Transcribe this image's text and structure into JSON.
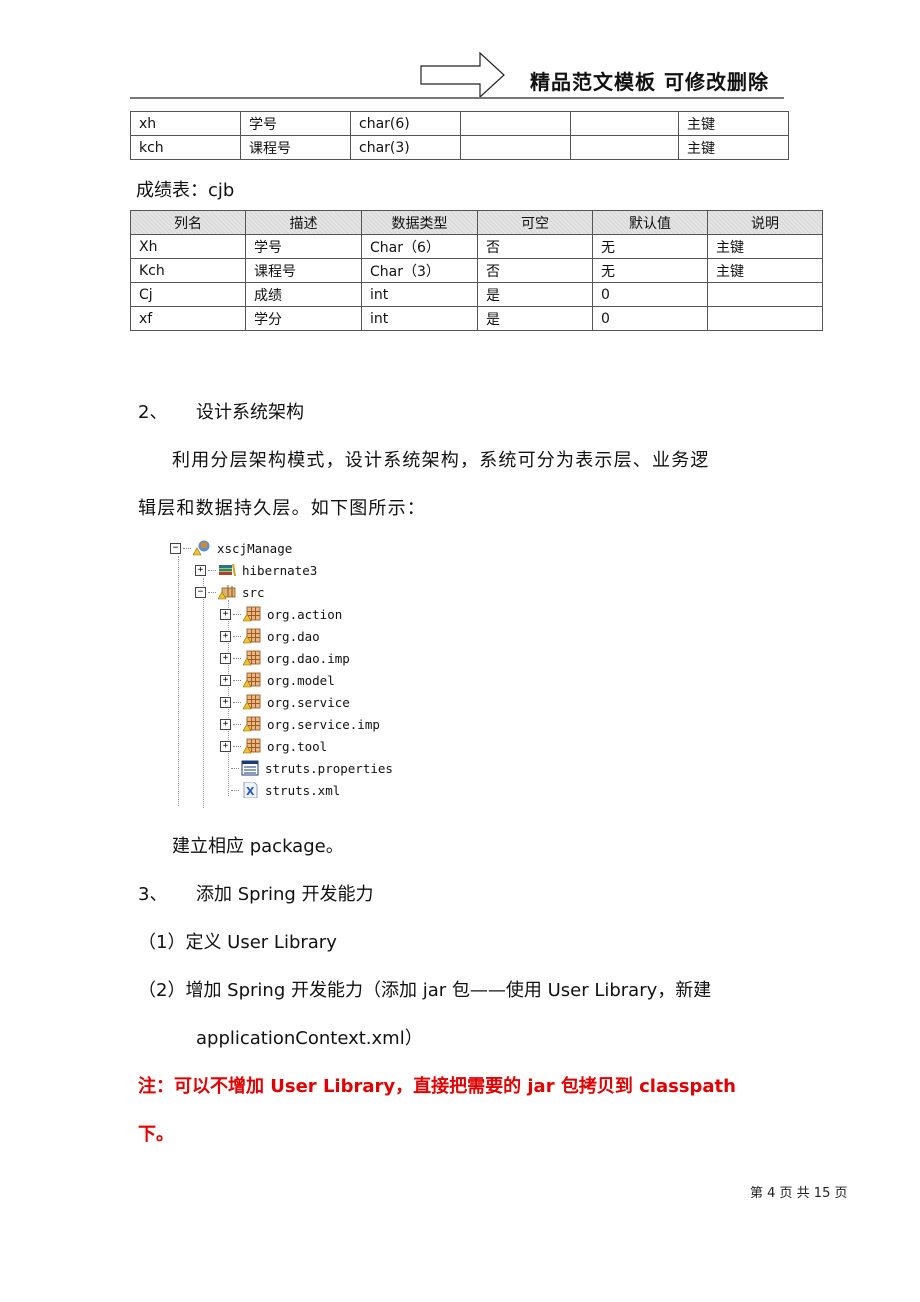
{
  "header": {
    "title": "精品范文模板 可修改删除",
    "arrow_icon": "right-arrow-outline"
  },
  "table1": {
    "rows": [
      [
        "xh",
        "学号",
        "char(6)",
        "",
        "",
        "主键"
      ],
      [
        "kch",
        "课程号",
        "char(3)",
        "",
        "",
        "主键"
      ]
    ]
  },
  "table2": {
    "caption": "成绩表：cjb",
    "columns": [
      "列名",
      "描述",
      "数据类型",
      "可空",
      "默认值",
      "说明"
    ],
    "rows": [
      [
        "Xh",
        "学号",
        "Char（6）",
        "否",
        "无",
        "主键"
      ],
      [
        "Kch",
        "课程号",
        "Char（3）",
        "否",
        "无",
        " 主键"
      ],
      [
        "Cj",
        "成绩",
        "int",
        "是",
        "0",
        ""
      ],
      [
        "xf",
        "学分",
        "int",
        "是",
        "0",
        ""
      ]
    ]
  },
  "section2": {
    "number": "2、",
    "title": "设计系统架构",
    "para_line1": "利用分层架构模式，设计系统架构，系统可分为表示层、业务逻",
    "para_line2": "辑层和数据持久层。如下图所示："
  },
  "tree": {
    "nodes": [
      {
        "label": "xscjManage",
        "toggle": "−",
        "icon": "project-icon"
      },
      {
        "label": "hibernate3",
        "toggle": "+",
        "icon": "library-icon"
      },
      {
        "label": "src",
        "toggle": "−",
        "icon": "source-folder-icon"
      },
      {
        "label": "org.action",
        "toggle": "+",
        "icon": "package-icon"
      },
      {
        "label": "org.dao",
        "toggle": "+",
        "icon": "package-icon"
      },
      {
        "label": "org.dao.imp",
        "toggle": "+",
        "icon": "package-icon"
      },
      {
        "label": "org.model",
        "toggle": "+",
        "icon": "package-icon"
      },
      {
        "label": "org.service",
        "toggle": "+",
        "icon": "package-icon"
      },
      {
        "label": "org.service.imp",
        "toggle": "+",
        "icon": "package-icon"
      },
      {
        "label": "org.tool",
        "toggle": "+",
        "icon": "package-icon"
      },
      {
        "label": "struts.properties",
        "toggle": "",
        "icon": "properties-file-icon"
      },
      {
        "label": "struts.xml",
        "toggle": "",
        "icon": "xml-file-icon"
      }
    ]
  },
  "after_tree": "建立相应 package。",
  "section3": {
    "number": "3、",
    "title": "添加 Spring 开发能力",
    "item1": "（1）定义 User Library",
    "item2_line1": "（2）增加 Spring 开发能力（添加 jar 包——使用 User Library，新建",
    "item2_line2": "applicationContext.xml）"
  },
  "note": {
    "line1": "注：可以不增加 User Library，直接把需要的 jar 包拷贝到 classpath",
    "line2": "下。",
    "color": "#e00000"
  },
  "footer": {
    "page_label": "第 4 页 共 15 页"
  }
}
